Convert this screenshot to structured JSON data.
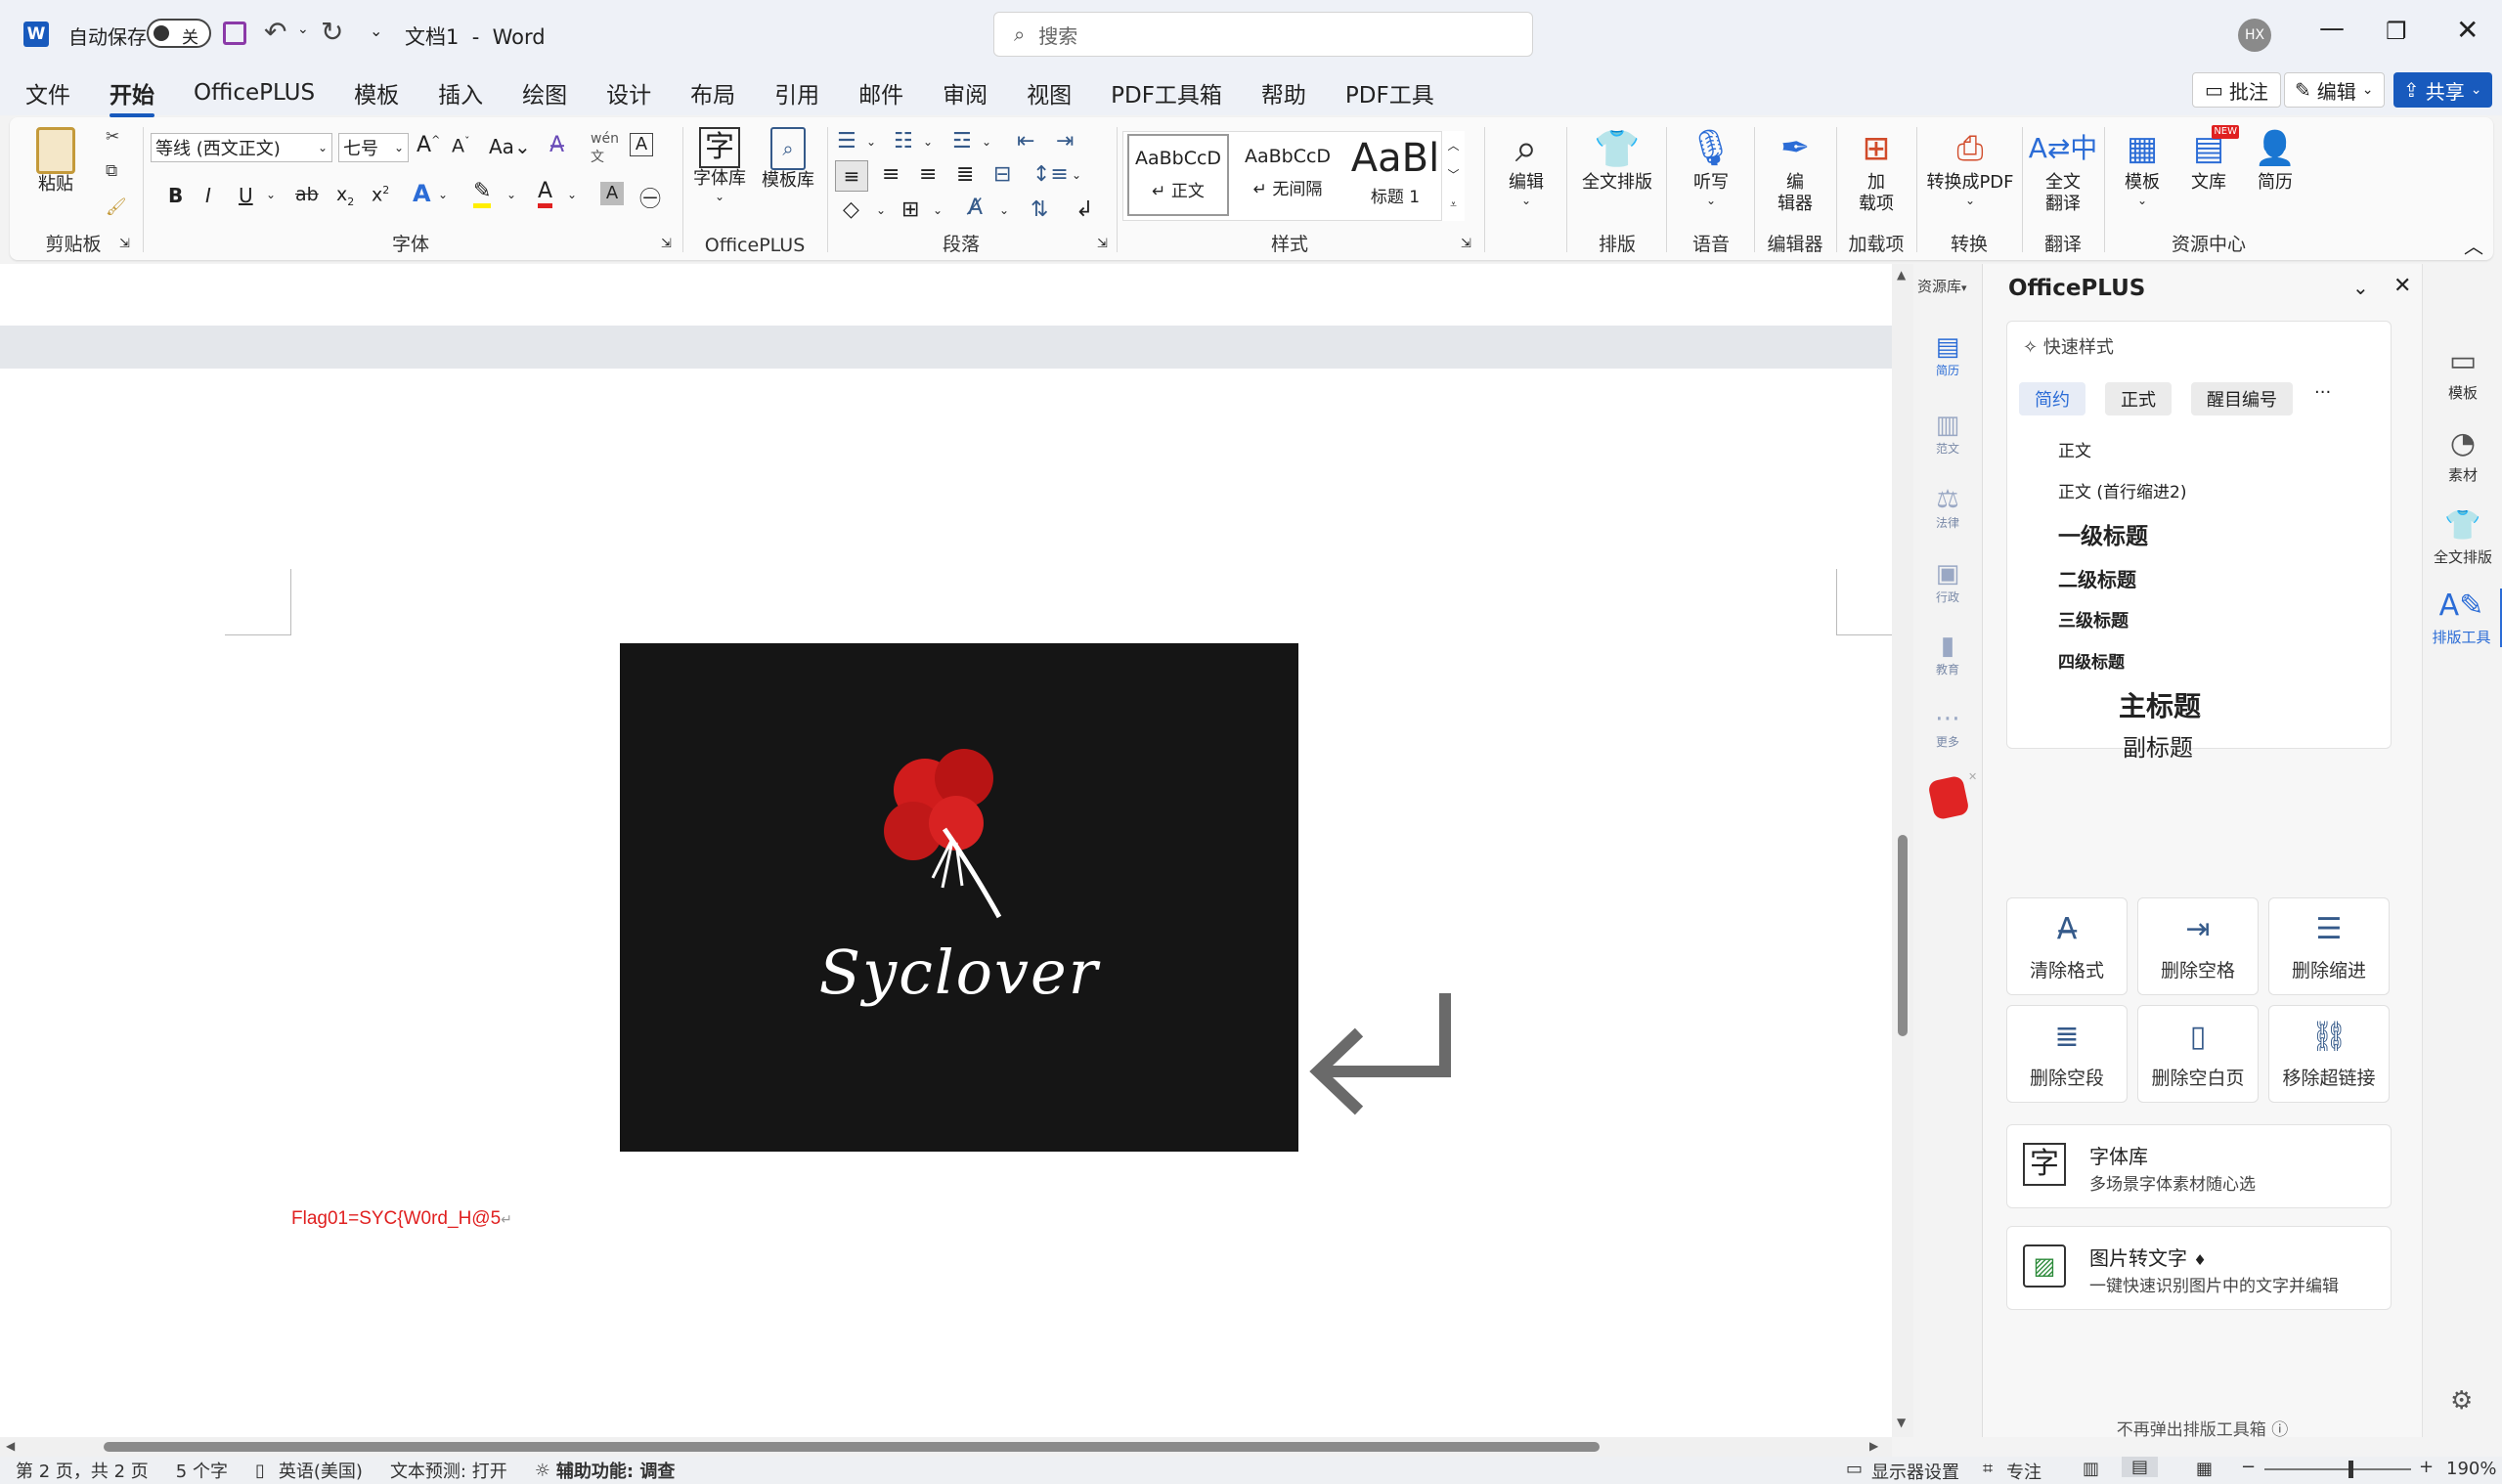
{
  "titlebar": {
    "autosave_label": "自动保存",
    "autosave_state": "关",
    "doc_title": "文档1  -  Word",
    "search_placeholder": "搜索",
    "user_initials": "HX"
  },
  "menu": [
    "文件",
    "开始",
    "OfficePLUS",
    "模板",
    "插入",
    "绘图",
    "设计",
    "布局",
    "引用",
    "邮件",
    "审阅",
    "视图",
    "PDF工具箱",
    "帮助",
    "PDF工具"
  ],
  "menu_right": {
    "comment": "批注",
    "edit": "编辑",
    "share": "共享"
  },
  "ribbon": {
    "clipboard": {
      "paste": "粘贴",
      "group": "剪贴板"
    },
    "font": {
      "font_name": "等线 (西文正文)",
      "font_size": "七号",
      "group": "字体"
    },
    "officeplus": {
      "fontlib": "字体库",
      "templatelib": "模板库",
      "group": "OfficePLUS"
    },
    "paragraph": {
      "group": "段落"
    },
    "styles": {
      "items": [
        {
          "preview": "AaBbCcD",
          "name": "↵ 正文"
        },
        {
          "preview": "AaBbCcD",
          "name": "↵ 无间隔"
        },
        {
          "preview": "AaBl",
          "name": "标题 1"
        }
      ],
      "group": "样式"
    },
    "editing": {
      "label": "编辑"
    },
    "layout": {
      "label": "全文排版",
      "group": "排版"
    },
    "voice": {
      "label": "听写",
      "group": "语音"
    },
    "editor": {
      "label": "编\n辑器",
      "group": "编辑器"
    },
    "addins": {
      "label": "加\n载项",
      "group": "加载项"
    },
    "convert": {
      "label": "转换成PDF",
      "group": "转换"
    },
    "translate": {
      "label": "全文\n翻译",
      "group": "翻译"
    },
    "resource": {
      "template": "模板",
      "library": "文库",
      "resume": "简历",
      "group": "资源中心",
      "new_badge": "NEW"
    }
  },
  "document": {
    "image_caption": "Syclover",
    "flag_text": "Flag01=SYC{W0rd_H@5",
    "paragraph_mark": "↵"
  },
  "left_sidebar": {
    "header": "资源库",
    "items": [
      "简历",
      "范文",
      "法律",
      "行政",
      "教育",
      "更多"
    ]
  },
  "panel": {
    "title": "OfficePLUS",
    "quick_style_label": "快速样式",
    "tabs": [
      "简约",
      "正式",
      "醒目编号",
      "···"
    ],
    "styles": [
      "正文",
      "正文 (首行缩进2)",
      "一级标题",
      "二级标题",
      "三级标题",
      "四级标题",
      "主标题",
      "副标题"
    ],
    "tools": [
      "清除格式",
      "删除空格",
      "删除缩进",
      "删除空段",
      "删除空白页",
      "移除超链接"
    ],
    "fontlib_title": "字体库",
    "fontlib_desc": "多场景字体素材随心选",
    "ocr_title": "图片转文字",
    "ocr_desc": "一键快速识别图片中的文字并编辑",
    "footer": "不再弹出排版工具箱"
  },
  "rail": [
    "模板",
    "素材",
    "全文排版",
    "排版工具"
  ],
  "status": {
    "page": "第 2 页，共 2 页",
    "words": "5 个字",
    "language": "英语(美国)",
    "prediction": "文本预测: 打开",
    "accessibility": "辅助功能: 调查",
    "display": "显示器设置",
    "focus": "专注",
    "zoom": "190%"
  },
  "colors": {
    "accent": "#185abd",
    "flag_red": "#e02020",
    "image_bg": "#151515"
  }
}
